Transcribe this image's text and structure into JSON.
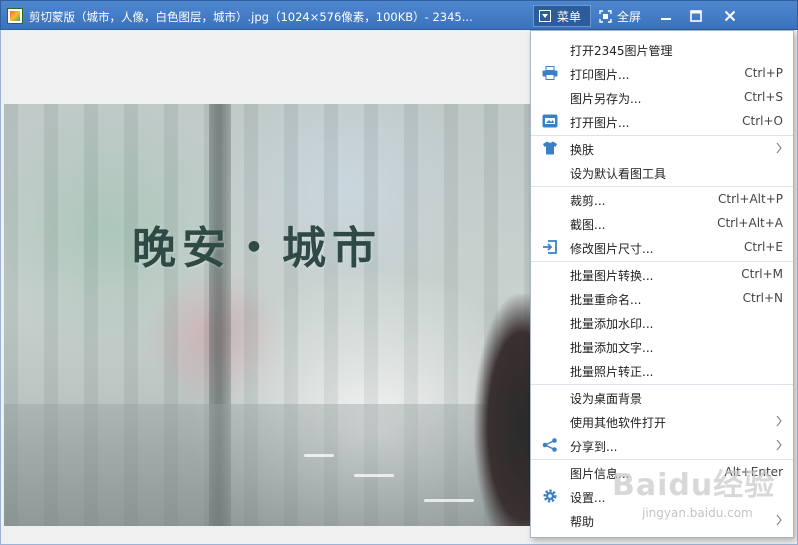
{
  "window": {
    "title": "剪切蒙版（城市，人像，白色图层，城市）.jpg（1024×576像素，100KB）- 2345...",
    "menu_label": "菜单",
    "fullscreen_label": "全屏"
  },
  "photo": {
    "overlay_text": "晚安・城市"
  },
  "menu": {
    "items": [
      {
        "label": "打开2345图片管理",
        "shortcut": "",
        "icon": ""
      },
      {
        "label": "打印图片...",
        "shortcut": "Ctrl+P",
        "icon": "printer-icon"
      },
      {
        "label": "图片另存为...",
        "shortcut": "Ctrl+S",
        "icon": ""
      },
      {
        "label": "打开图片...",
        "shortcut": "Ctrl+O",
        "icon": "open-image-icon"
      },
      {
        "label": "换肤",
        "shortcut": "",
        "icon": "tshirt-icon",
        "submenu": true
      },
      {
        "label": "设为默认看图工具",
        "shortcut": "",
        "icon": ""
      },
      {
        "label": "裁剪...",
        "shortcut": "Ctrl+Alt+P",
        "icon": ""
      },
      {
        "label": "截图...",
        "shortcut": "Ctrl+Alt+A",
        "icon": ""
      },
      {
        "label": "修改图片尺寸...",
        "shortcut": "Ctrl+E",
        "icon": "resize-icon"
      },
      {
        "label": "批量图片转换...",
        "shortcut": "Ctrl+M",
        "icon": ""
      },
      {
        "label": "批量重命名...",
        "shortcut": "Ctrl+N",
        "icon": ""
      },
      {
        "label": "批量添加水印...",
        "shortcut": "",
        "icon": ""
      },
      {
        "label": "批量添加文字...",
        "shortcut": "",
        "icon": ""
      },
      {
        "label": "批量照片转正...",
        "shortcut": "",
        "icon": ""
      },
      {
        "label": "设为桌面背景",
        "shortcut": "",
        "icon": ""
      },
      {
        "label": "使用其他软件打开",
        "shortcut": "",
        "icon": "",
        "submenu": true
      },
      {
        "label": "分享到...",
        "shortcut": "",
        "icon": "share-icon",
        "submenu": true
      },
      {
        "label": "图片信息...",
        "shortcut": "Alt+Enter",
        "icon": ""
      },
      {
        "label": "设置...",
        "shortcut": "",
        "icon": "gear-icon"
      },
      {
        "label": "帮助",
        "shortcut": "",
        "icon": "",
        "submenu": true
      }
    ]
  },
  "watermark": {
    "brand": "Baidu经验",
    "url": "jingyan.baidu.com"
  },
  "colors": {
    "titlebar": "#3a72bd",
    "menu_icon": "#3d7fc4"
  }
}
